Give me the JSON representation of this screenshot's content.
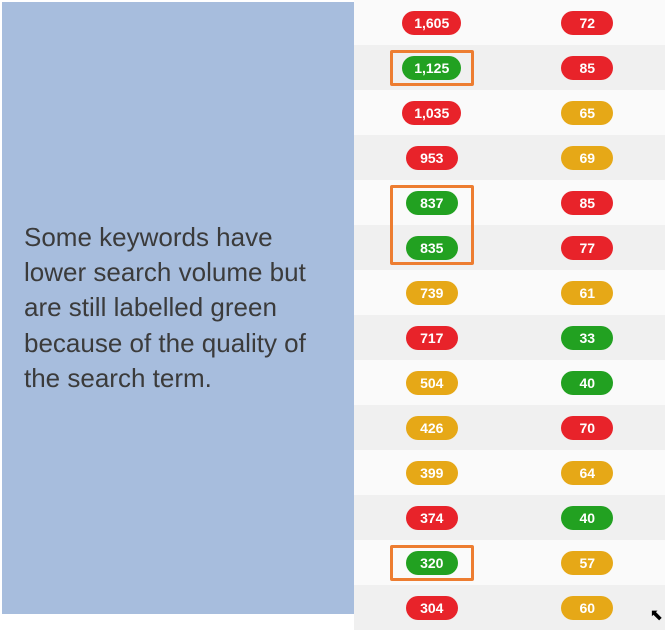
{
  "callout": {
    "text": "Some keywords have lower search volume but are still labelled green because of the quality of the search term."
  },
  "rows": [
    {
      "vol": {
        "value": "1,605",
        "color": "red",
        "hl": false
      },
      "diff": {
        "value": "72",
        "color": "red"
      }
    },
    {
      "vol": {
        "value": "1,125",
        "color": "green",
        "hl": true
      },
      "diff": {
        "value": "85",
        "color": "red"
      }
    },
    {
      "vol": {
        "value": "1,035",
        "color": "red",
        "hl": false
      },
      "diff": {
        "value": "65",
        "color": "amber"
      }
    },
    {
      "vol": {
        "value": "953",
        "color": "red",
        "hl": false
      },
      "diff": {
        "value": "69",
        "color": "amber"
      }
    },
    {
      "vol": {
        "value": "837",
        "color": "green",
        "hl": false
      },
      "diff": {
        "value": "85",
        "color": "red"
      }
    },
    {
      "vol": {
        "value": "835",
        "color": "green",
        "hl": false
      },
      "diff": {
        "value": "77",
        "color": "red"
      }
    },
    {
      "vol": {
        "value": "739",
        "color": "amber",
        "hl": false
      },
      "diff": {
        "value": "61",
        "color": "amber"
      }
    },
    {
      "vol": {
        "value": "717",
        "color": "red",
        "hl": false
      },
      "diff": {
        "value": "33",
        "color": "green"
      }
    },
    {
      "vol": {
        "value": "504",
        "color": "amber",
        "hl": false
      },
      "diff": {
        "value": "40",
        "color": "green"
      }
    },
    {
      "vol": {
        "value": "426",
        "color": "amber",
        "hl": false
      },
      "diff": {
        "value": "70",
        "color": "red"
      }
    },
    {
      "vol": {
        "value": "399",
        "color": "amber",
        "hl": false
      },
      "diff": {
        "value": "64",
        "color": "amber"
      }
    },
    {
      "vol": {
        "value": "374",
        "color": "red",
        "hl": false
      },
      "diff": {
        "value": "40",
        "color": "green"
      }
    },
    {
      "vol": {
        "value": "320",
        "color": "green",
        "hl": true
      },
      "diff": {
        "value": "57",
        "color": "amber"
      }
    },
    {
      "vol": {
        "value": "304",
        "color": "red",
        "hl": false
      },
      "diff": {
        "value": "60",
        "color": "amber"
      }
    }
  ],
  "double_highlight_rows": [
    4,
    5
  ]
}
